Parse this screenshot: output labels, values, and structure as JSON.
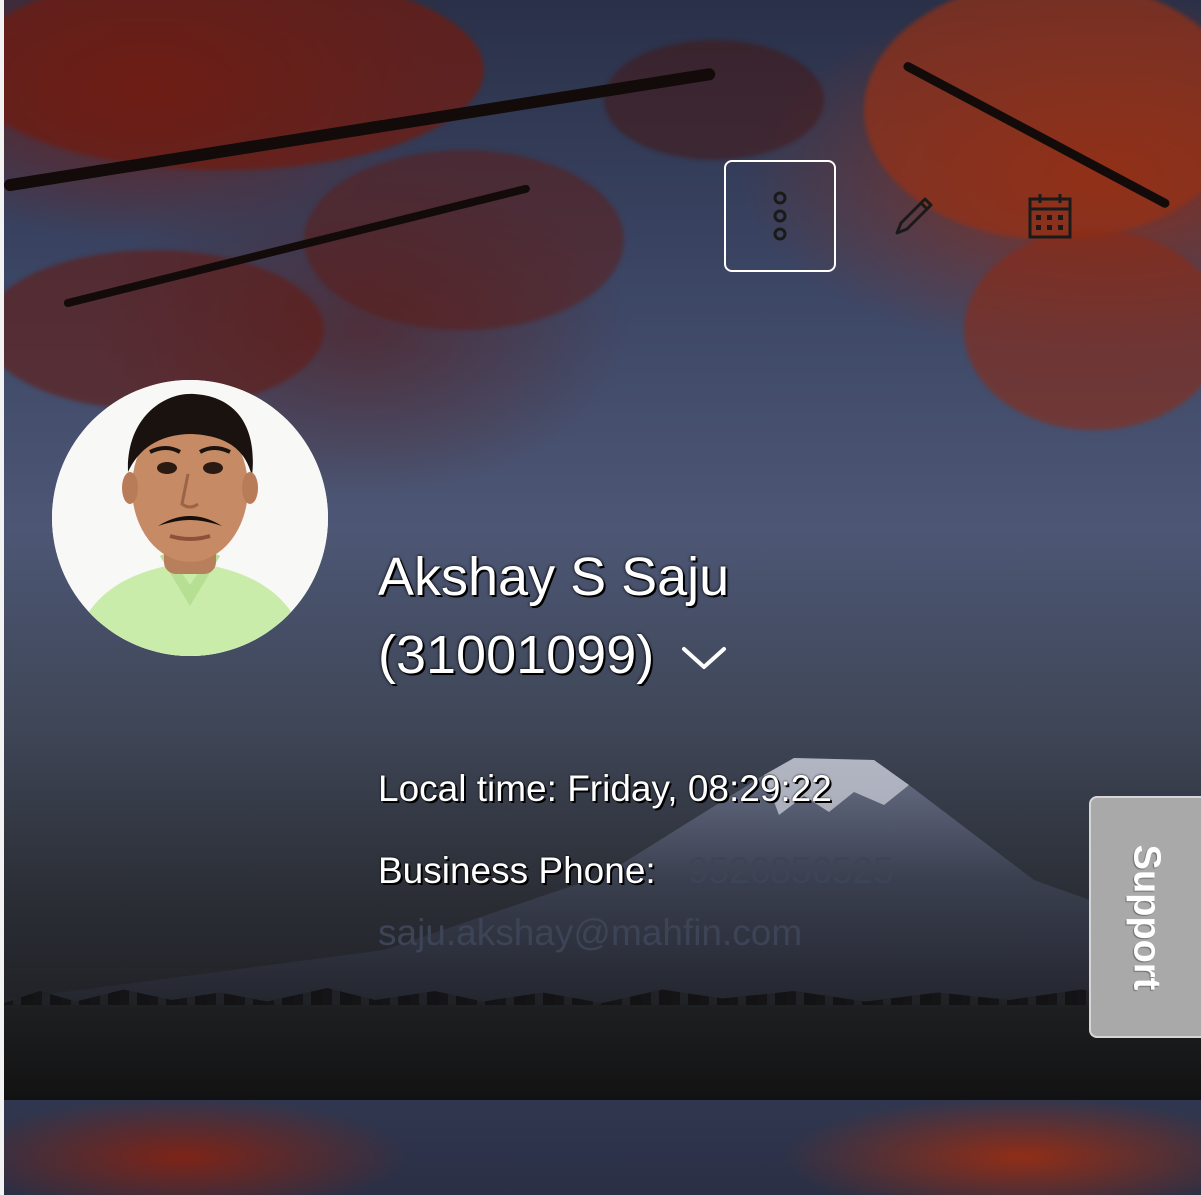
{
  "header": {
    "actions": [
      {
        "name": "more-options",
        "icon": "vertical-ellipsis-icon"
      },
      {
        "name": "edit",
        "icon": "pencil-icon"
      },
      {
        "name": "calendar",
        "icon": "calendar-icon"
      }
    ]
  },
  "profile": {
    "name": "Akshay S Saju",
    "employee_id": "(31001099)",
    "expand_icon": "chevron-down-icon",
    "local_time_label": "Local time:",
    "local_time_value": "Friday, 08:29:22",
    "phone_label": "Business Phone:",
    "phone_value": "9526856525",
    "email": "saju.akshay@mahfin.com"
  },
  "support": {
    "label": "Support"
  },
  "colors": {
    "text": "#ffffff",
    "muted_text": "#3d4456",
    "support_tab": "#a9a9aa",
    "foliage": "#8a2a17"
  }
}
